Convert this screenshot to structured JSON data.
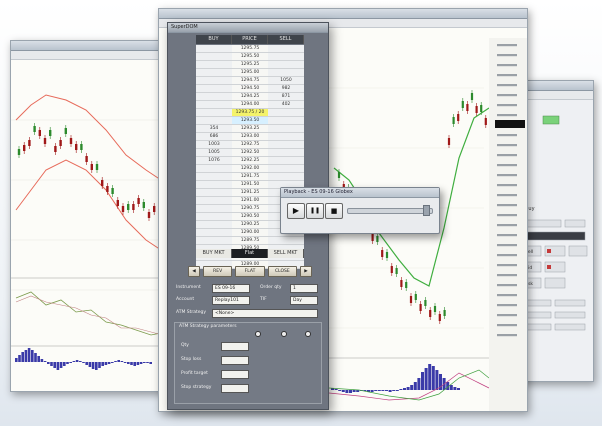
{
  "playback": {
    "title": "Playback - ES 09-16 Globex",
    "play_icon": "▶",
    "pause_icon": "❚❚",
    "stop_icon": "■"
  },
  "dom": {
    "title": "SuperDOM",
    "headers": [
      "BUY",
      "PRICE",
      "SELL"
    ],
    "rows": [
      {
        "buy": "",
        "price": "1295.75",
        "sell": ""
      },
      {
        "buy": "",
        "price": "1295.50",
        "sell": ""
      },
      {
        "buy": "",
        "price": "1295.25",
        "sell": ""
      },
      {
        "buy": "",
        "price": "1295.00",
        "sell": ""
      },
      {
        "buy": "",
        "price": "1294.75",
        "sell": "1050"
      },
      {
        "buy": "",
        "price": "1294.50",
        "sell": "982"
      },
      {
        "buy": "",
        "price": "1294.25",
        "sell": "871"
      },
      {
        "buy": "",
        "price": "1294.00",
        "sell": "402"
      },
      {
        "buy": "",
        "price": "1293.75 / 20",
        "sell": "",
        "hl": true
      },
      {
        "buy": "",
        "price": "1293.50",
        "sell": "",
        "bid": true
      },
      {
        "buy": "354",
        "price": "1293.25",
        "sell": ""
      },
      {
        "buy": "686",
        "price": "1293.00",
        "sell": ""
      },
      {
        "buy": "1003",
        "price": "1292.75",
        "sell": ""
      },
      {
        "buy": "1005",
        "price": "1292.50",
        "sell": ""
      },
      {
        "buy": "1076",
        "price": "1292.25",
        "sell": ""
      },
      {
        "buy": "",
        "price": "1292.00",
        "sell": ""
      },
      {
        "buy": "",
        "price": "1291.75",
        "sell": ""
      },
      {
        "buy": "",
        "price": "1291.50",
        "sell": ""
      },
      {
        "buy": "",
        "price": "1291.25",
        "sell": ""
      },
      {
        "buy": "",
        "price": "1291.00",
        "sell": ""
      },
      {
        "buy": "",
        "price": "1290.75",
        "sell": ""
      },
      {
        "buy": "",
        "price": "1290.50",
        "sell": ""
      },
      {
        "buy": "",
        "price": "1290.25",
        "sell": ""
      },
      {
        "buy": "",
        "price": "1290.00",
        "sell": ""
      },
      {
        "buy": "",
        "price": "1289.75",
        "sell": ""
      },
      {
        "buy": "",
        "price": "1289.50",
        "sell": ""
      },
      {
        "buy": "",
        "price": "1289.25",
        "sell": ""
      },
      {
        "buy": "",
        "price": "1289.00",
        "sell": ""
      }
    ],
    "footer": [
      "BUY MKT",
      "Flat",
      "SELL MKT"
    ],
    "buttons": [
      "REV",
      "FLAT",
      "CLOSE"
    ],
    "instrument_label": "Instrument",
    "instrument_value": "ES 09-16",
    "account_label": "Account",
    "account_value": "Replay101",
    "qty_label": "Order qty",
    "qty_value": "1",
    "tif_label": "TIF",
    "tif_value": "Day",
    "atm_label": "ATM Strategy",
    "atm_value": "<None>",
    "params_title": "ATM Strategy parameters",
    "param_labels": [
      "Qty",
      "Stop loss",
      "Profit target",
      "Stop strategy"
    ]
  },
  "right_window": {
    "side_labels": [
      "Buy",
      "Sell",
      "Bid",
      "Ask"
    ]
  },
  "colors": {
    "candle_up": "#2c8a2c",
    "candle_down": "#a01818",
    "envelope": "#e76a5a",
    "trend_green": "#3fae3f",
    "hist_blue": "#3a3aa8"
  }
}
